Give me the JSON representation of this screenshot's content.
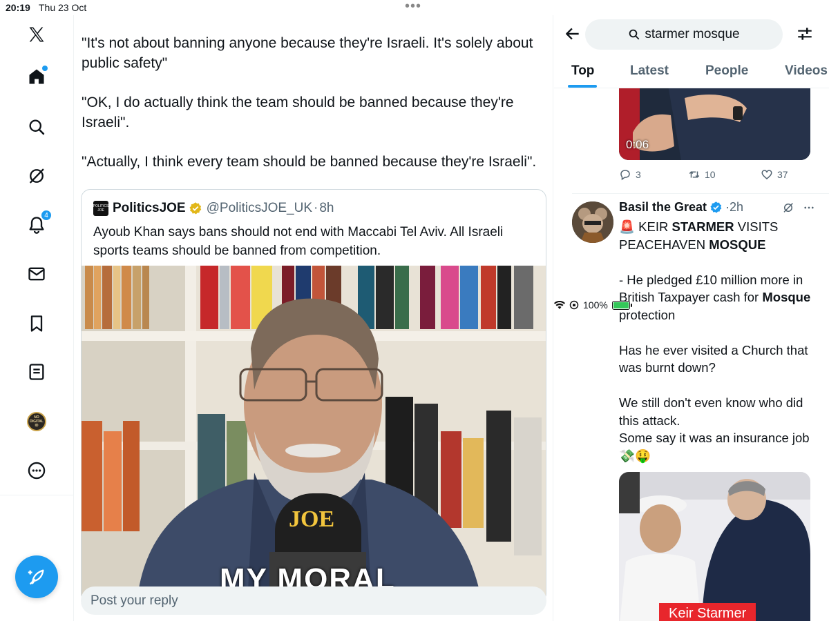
{
  "status_bar": {
    "time": "20:19",
    "date": "Thu 23 Oct",
    "battery": "100%",
    "battery_level": 1.0,
    "battery_color": "#34c759"
  },
  "nav": {
    "items": [
      {
        "icon": "x-logo-icon"
      },
      {
        "icon": "home-icon"
      },
      {
        "icon": "search-icon"
      },
      {
        "icon": "grok-icon"
      },
      {
        "icon": "bell-icon",
        "badge": "4"
      },
      {
        "icon": "mail-icon"
      },
      {
        "icon": "bookmark-icon"
      },
      {
        "icon": "lists-icon"
      },
      {
        "icon": "profile-avatar",
        "label": "NO DIGITAL ID"
      },
      {
        "icon": "more-icon"
      }
    ],
    "compose_icon": "compose-icon",
    "accent": "#1d9bf0"
  },
  "main": {
    "tweet_paragraphs": [
      "\"It's not about banning anyone because they're Israeli. It's solely about public safety\"",
      "\"OK, I do actually think the team should be banned because they're Israeli\".",
      "\"Actually, I think every team should be banned because they're Israeli\"."
    ],
    "quote": {
      "logo_text": "POLITICS JOE",
      "name": "PoliticsJOE",
      "handle": "@PoliticsJOE_UK",
      "separator": "·",
      "time": "8h",
      "text": "Ayoub Khan says bans should not end with Maccabi Tel Aviv. All Israeli sports teams should be banned from competition.",
      "mic_label": "JOE",
      "caption": "MY MORAL"
    },
    "reply_placeholder": "Post your reply"
  },
  "search": {
    "query": "starmer mosque",
    "tabs": [
      "Top",
      "Latest",
      "People",
      "Videos"
    ],
    "active_tab": "Top",
    "video": {
      "duration": "0:06",
      "replies": "3",
      "reposts": "10",
      "likes": "37"
    },
    "post": {
      "name": "Basil the Great",
      "separator": "·",
      "time": "2h",
      "line1_pre": "🚨 KEIR ",
      "line1_b1": "STARMER",
      "line1_mid": " VISITS PEACEHAVEN ",
      "line1_b2": "MOSQUE",
      "para2_pre": "- He pledged £10 million more in British Taxpayer cash for ",
      "para2_b": "Mosque",
      "para2_post": " protection",
      "para3": "Has he ever visited a Church that was burnt down?",
      "para4": "We still don't even know who did this attack.",
      "para5": "Some say it was an insurance job 💸🤑",
      "media_label": "Keir Starmer"
    }
  }
}
